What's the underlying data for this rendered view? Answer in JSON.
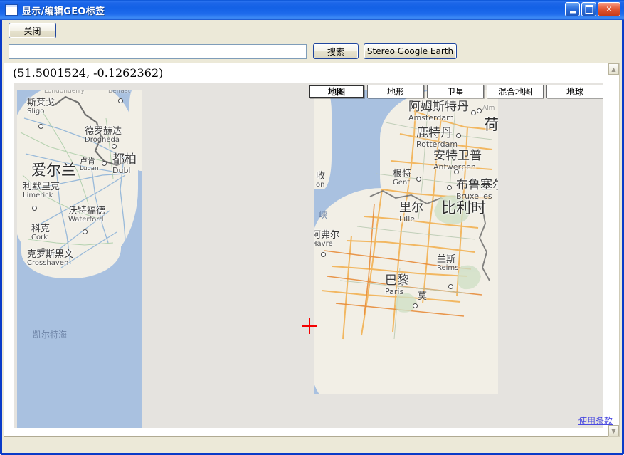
{
  "window": {
    "title": "显示/编辑GEO标签",
    "icon": "window-icon",
    "controls": {
      "minimize": "minimize-icon",
      "maximize": "maximize-icon",
      "close": "close-icon"
    }
  },
  "toolbar": {
    "close_label": "关闭"
  },
  "search": {
    "value": "",
    "placeholder": "",
    "search_label": "搜索",
    "stereo_label": "Stereo Google Earth"
  },
  "coordinates": {
    "text": "(51.5001524, -0.1262362)",
    "latitude": "51.5001524",
    "longitude": "-0.1262362"
  },
  "map": {
    "types": [
      {
        "label": "地图",
        "selected": true
      },
      {
        "label": "地形",
        "selected": false
      },
      {
        "label": "卫星",
        "selected": false
      },
      {
        "label": "混合地图",
        "selected": false
      },
      {
        "label": "地球",
        "selected": false
      }
    ],
    "marker": "crosshair-marker",
    "terms_label": "使用条款",
    "labels_left": [
      {
        "cn": "斯莱戈",
        "en": "Sligo"
      },
      {
        "cn": "德罗赫达",
        "en": "Drogheda"
      },
      {
        "cn": "卢肯",
        "en": "Lucan"
      },
      {
        "cn": "都柏",
        "en": "Dubl"
      },
      {
        "cn": "爱尔兰",
        "en": ""
      },
      {
        "cn": "利默里克",
        "en": "Limerick"
      },
      {
        "cn": "沃特福德",
        "en": "Waterford"
      },
      {
        "cn": "科克",
        "en": "Cork"
      },
      {
        "cn": "克罗斯黑文",
        "en": "Crosshaven"
      },
      {
        "cn": "凯尔特海",
        "en": ""
      },
      {
        "cn": "",
        "en": "Londonderry"
      },
      {
        "cn": "",
        "en": "Belfast"
      }
    ],
    "labels_right": [
      {
        "cn": "阿姆斯特丹",
        "en": "Amsterdam"
      },
      {
        "cn": "",
        "en": "Alm"
      },
      {
        "cn": "荷",
        "en": ""
      },
      {
        "cn": "鹿特丹",
        "en": "Rotterdam"
      },
      {
        "cn": "安特卫普",
        "en": "Antwerpen"
      },
      {
        "cn": "根特",
        "en": "Gent"
      },
      {
        "cn": "布鲁塞尔",
        "en": "Bruxelles"
      },
      {
        "cn": "比利时",
        "en": ""
      },
      {
        "cn": "里尔",
        "en": "Lille"
      },
      {
        "cn": "兰斯",
        "en": "Reims"
      },
      {
        "cn": "巴黎",
        "en": "Paris"
      },
      {
        "cn": "莫",
        "en": ""
      },
      {
        "cn": "阿弗尔",
        "en": "Havre"
      },
      {
        "cn": "收",
        "en": "on"
      },
      {
        "cn": "峡",
        "en": ""
      }
    ]
  },
  "colors": {
    "title_bar": "#1361e6",
    "window_border": "#0a3bc8",
    "face": "#ece9d8",
    "marker": "#f40000",
    "link": "#4a4ae0",
    "sea": "#a9c1e0",
    "land": "#f2efe6"
  }
}
